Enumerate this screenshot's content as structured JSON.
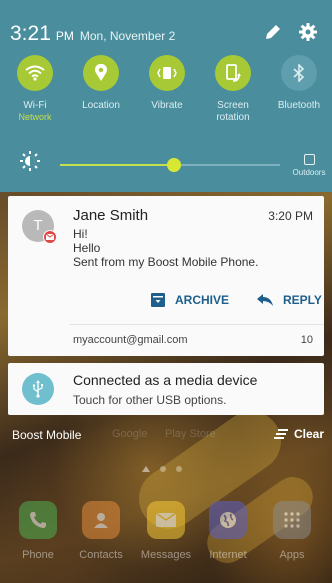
{
  "status_bar": {
    "time": "3:21",
    "ampm": "PM",
    "date": "Mon, November 2",
    "edit_icon": "pencil-icon",
    "settings_icon": "gear-icon"
  },
  "quick_toggles": [
    {
      "label": "Wi-Fi",
      "sublabel": "Network",
      "icon": "wifi-icon",
      "state": "on"
    },
    {
      "label": "Location",
      "sublabel": "",
      "icon": "location-pin-icon",
      "state": "on"
    },
    {
      "label": "Vibrate",
      "sublabel": "",
      "icon": "vibrate-icon",
      "state": "on"
    },
    {
      "label": "Screen",
      "sublabel": "rotation",
      "icon": "screen-rotation-icon",
      "state": "on"
    },
    {
      "label": "Bluetooth",
      "sublabel": "",
      "icon": "bluetooth-icon",
      "state": "off"
    }
  ],
  "brightness": {
    "level": 0.52,
    "outdoors_label": "Outdoors"
  },
  "email_notification": {
    "avatar_letter": "T",
    "sender": "Jane Smith",
    "time": "3:20 PM",
    "subject": "Hi!",
    "line1": "Hello",
    "line2": "Sent from my Boost Mobile Phone.",
    "archive_label": "ARCHIVE",
    "reply_label": "REPLY",
    "account": "myaccount@gmail.com",
    "count": "10"
  },
  "usb_notification": {
    "title": "Connected as a media device",
    "subtitle": "Touch for other USB options."
  },
  "carrier": "Boost Mobile",
  "clear_label": "Clear",
  "background_text": {
    "google": "Google",
    "play_store": "Play Store"
  },
  "dock": [
    {
      "label": "Phone",
      "icon": "phone-icon",
      "color": "#4caf50"
    },
    {
      "label": "Contacts",
      "icon": "contacts-icon",
      "color": "#e08a3c"
    },
    {
      "label": "Messages",
      "icon": "messages-icon",
      "color": "#f2c534"
    },
    {
      "label": "Internet",
      "icon": "internet-icon",
      "color": "#5b5fc7"
    },
    {
      "label": "Apps",
      "icon": "apps-grid-icon",
      "color": "#8a8a8a"
    }
  ],
  "colors": {
    "panel": "#4a8d9c",
    "toggle_on": "#a6c935",
    "action_blue": "#1e5f8c"
  }
}
